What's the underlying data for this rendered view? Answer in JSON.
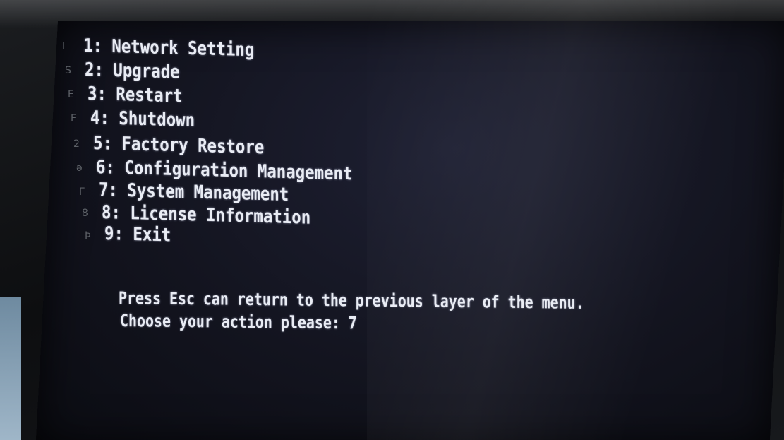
{
  "menu": {
    "items": [
      {
        "number": "1",
        "label": "1: Network Setting"
      },
      {
        "number": "2",
        "label": "2: Upgrade"
      },
      {
        "number": "3",
        "label": "3: Restart"
      },
      {
        "number": "4",
        "label": "4: Shutdown"
      },
      {
        "number": "5",
        "label": "5: Factory Restore"
      },
      {
        "number": "6",
        "label": "6: Configuration Management"
      },
      {
        "number": "7",
        "label": "7: System Management"
      },
      {
        "number": "8",
        "label": "8: License Information"
      },
      {
        "number": "9",
        "label": "9: Exit"
      }
    ]
  },
  "prompt": {
    "hint": "Press Esc can return to the previous layer of the menu.",
    "question": "Choose your action please: 7"
  },
  "colors": {
    "text": "#e9ecf4",
    "screen_background": "#13141f",
    "bezel": "#0d0e10"
  }
}
